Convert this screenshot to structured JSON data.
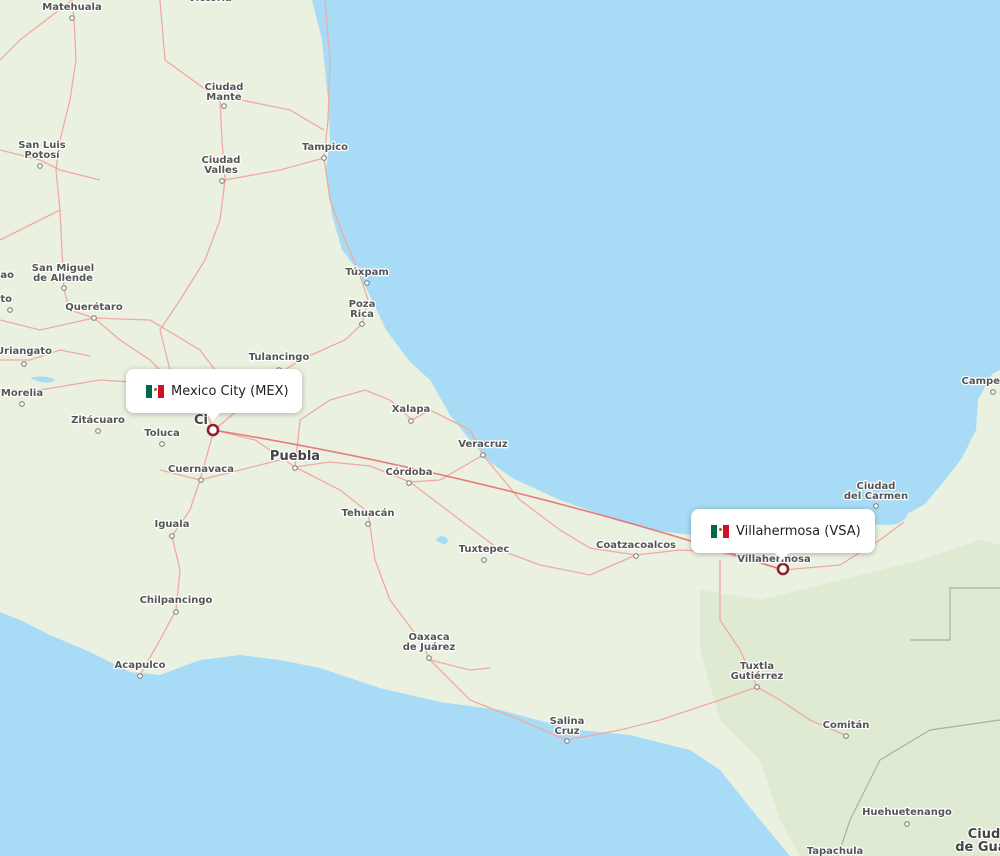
{
  "colors": {
    "water": "#a8dcf6",
    "land": "#eaf1e0",
    "forest": "#dce9cf",
    "road": "#f0a9a3",
    "route": "#e86e6e",
    "marker": "#8e2231",
    "mexico_flag": [
      "#006847",
      "#ffffff",
      "#ce1126"
    ]
  },
  "route": {
    "origin": {
      "name": "Mexico City (MEX)",
      "country_flag": "mexico-flag-icon"
    },
    "destination": {
      "name": "Villahermosa (VSA)",
      "country_flag": "mexico-flag-icon"
    }
  },
  "cities": [
    {
      "name": "Matehuala"
    },
    {
      "name": "Ciudad\nMante"
    },
    {
      "name": "San Luis\nPotosí"
    },
    {
      "name": "Tampico"
    },
    {
      "name": "Ciudad\nValles"
    },
    {
      "name": "San Miguel\nde Allende"
    },
    {
      "name": "Querétaro"
    },
    {
      "name": "Túxpam"
    },
    {
      "name": "Poza\nRica"
    },
    {
      "name": "Tulancingo"
    },
    {
      "name": "Uriangato"
    },
    {
      "name": "Morelia"
    },
    {
      "name": "Zitácuaro"
    },
    {
      "name": "Toluca"
    },
    {
      "name": "Ci"
    },
    {
      "name": "Xalapa"
    },
    {
      "name": "Veracruz"
    },
    {
      "name": "Puebla"
    },
    {
      "name": "Cuernavaca"
    },
    {
      "name": "Córdoba"
    },
    {
      "name": "Iguala"
    },
    {
      "name": "Tehuacán"
    },
    {
      "name": "Tuxtepec"
    },
    {
      "name": "Coatzacoalcos"
    },
    {
      "name": "Villahermosa"
    },
    {
      "name": "Ciudad\ndel Carmen"
    },
    {
      "name": "Chilpancingo"
    },
    {
      "name": "Oaxaca\nde Juárez"
    },
    {
      "name": "Acapulco"
    },
    {
      "name": "Tuxtla\nGutiérrez"
    },
    {
      "name": "Salina\nCruz"
    },
    {
      "name": "Comitán"
    },
    {
      "name": "Huehuetenango"
    },
    {
      "name": "Ciud\nde Guat"
    },
    {
      "name": "Tapachula"
    },
    {
      "name": "Campe"
    },
    {
      "name": "Victoria"
    },
    {
      "name": "uato"
    },
    {
      "name": "ao"
    }
  ]
}
